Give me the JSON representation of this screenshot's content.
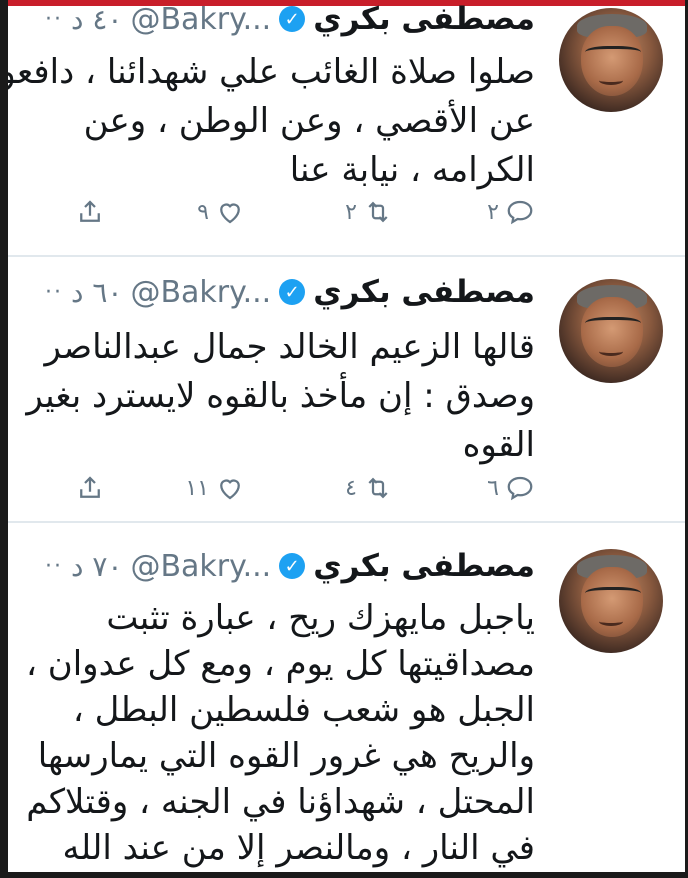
{
  "tweets": [
    {
      "name": "مصطفى بكري",
      "handle": "@Bakry...",
      "time": "٤٠ د",
      "more": "··",
      "lines": [
        "صلوا صلاة الغائب علي شهدائنا ، دافعو",
        "عن الأقصي ، وعن الوطن ، وعن",
        "الكرامه ، نيابة عنا"
      ],
      "replies": "٢",
      "retweets": "٢",
      "likes": "٩"
    },
    {
      "name": "مصطفى بكري",
      "handle": "@Bakry...",
      "time": "٦٠ د",
      "more": "··",
      "lines": [
        "قالها الزعيم الخالد جمال عبدالناصر",
        "وصدق : إن مأخذ بالقوه لايسترد بغير",
        "القوه"
      ],
      "replies": "٦",
      "retweets": "٤",
      "likes": "١١"
    },
    {
      "name": "مصطفى بكري",
      "handle": "@Bakry...",
      "time": "٧٠ د",
      "more": "··",
      "lines": [
        "ياجبل مايهزك ريح ، عبارة تثبت",
        "مصداقيتها كل يوم ، ومع كل عدوان ،",
        "الجبل هو شعب فلسطين البطل ،",
        "والريح هي غرور القوه التي يمارسها",
        "المحتل ، شهداؤنا في الجنه ، وقتلاكم",
        "في النار ، ومالنصر إلا من عند الله"
      ]
    }
  ],
  "colors": {
    "verified": "#1da1f2",
    "muted": "#657786",
    "text": "#14171a",
    "divider": "#e1e8ed"
  }
}
